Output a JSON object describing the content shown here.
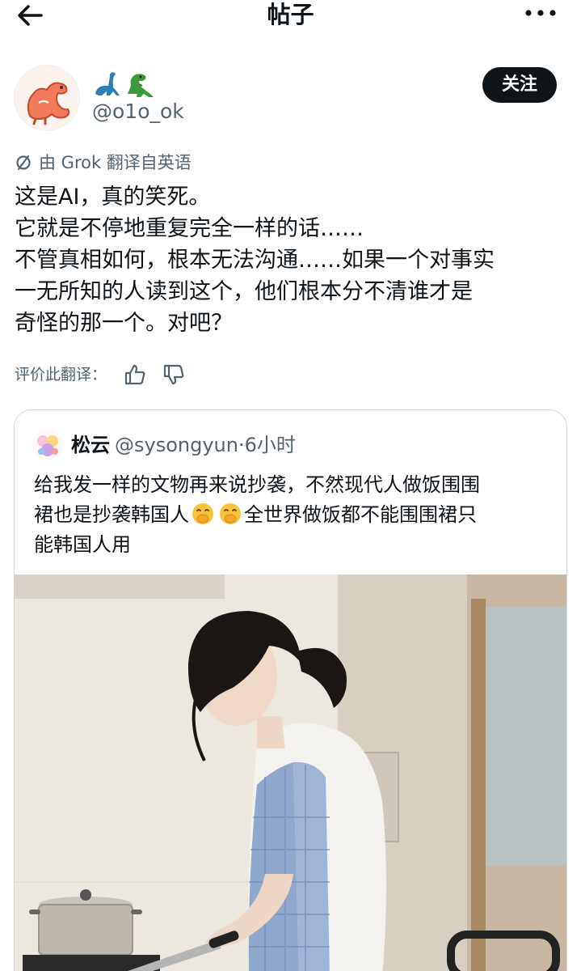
{
  "header": {
    "title": "帖子",
    "back_icon": "arrow-left-icon",
    "more_icon": "more-horizontal-icon"
  },
  "author": {
    "name_emoji": [
      "sauropod-emoji",
      "t-rex-emoji"
    ],
    "handle": "@o1o_ok",
    "follow_label": "关注"
  },
  "post": {
    "translated_label": "由 Grok 翻译自英语",
    "lines": [
      "这是AI，真的笑死。",
      "它就是不停地重复完全一样的话……",
      "不管真相如何，根本无法沟通……如果一个对事实",
      "一无所知的人读到这个，他们根本分不清谁才是",
      "奇怪的那一个。对吧？"
    ],
    "rate_label": "评价此翻译："
  },
  "quote": {
    "name": "松云",
    "handle": "@sysongyun",
    "time": "·6小时",
    "line1": "给我发一样的文物再来说抄袭，不然现代人做饭围围",
    "line2_a": "裙也是抄袭韩国人",
    "line2_b": "全世界做饭都不能围围裙只",
    "line3": "能韩国人用",
    "emoji": "face-with-hand-over-mouth-emoji"
  },
  "colors": {
    "text": "#0f1419",
    "secondary": "#536471",
    "border": "#cfd9de",
    "follow_bg": "#0f1419"
  }
}
